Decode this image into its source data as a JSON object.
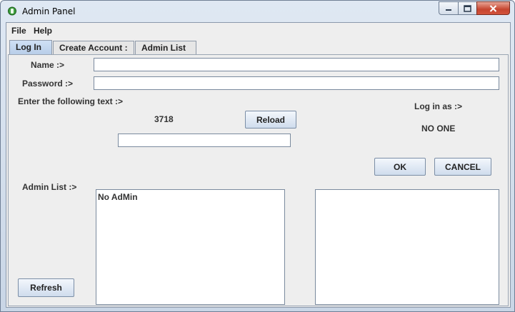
{
  "window": {
    "title": "Admin Panel"
  },
  "menu": {
    "items": [
      "File",
      "Help"
    ]
  },
  "tabs": [
    {
      "label": "Log In :",
      "active": true
    },
    {
      "label": "Create Account :",
      "active": false
    },
    {
      "label": "Admin List :",
      "active": false
    }
  ],
  "login": {
    "name_label": "Name :>",
    "name_value": "",
    "password_label": "Password :>",
    "password_value": "",
    "captcha_prompt": "Enter the following text :>",
    "captcha_code": "3718",
    "reload_label": "Reload",
    "captcha_input_value": "",
    "login_as_label": "Log in as :>",
    "login_as_value": "NO ONE",
    "ok_label": "OK",
    "cancel_label": "CANCEL"
  },
  "admin_list": {
    "label": "Admin List :>",
    "items": [
      "No AdMin"
    ],
    "refresh_label": "Refresh"
  }
}
